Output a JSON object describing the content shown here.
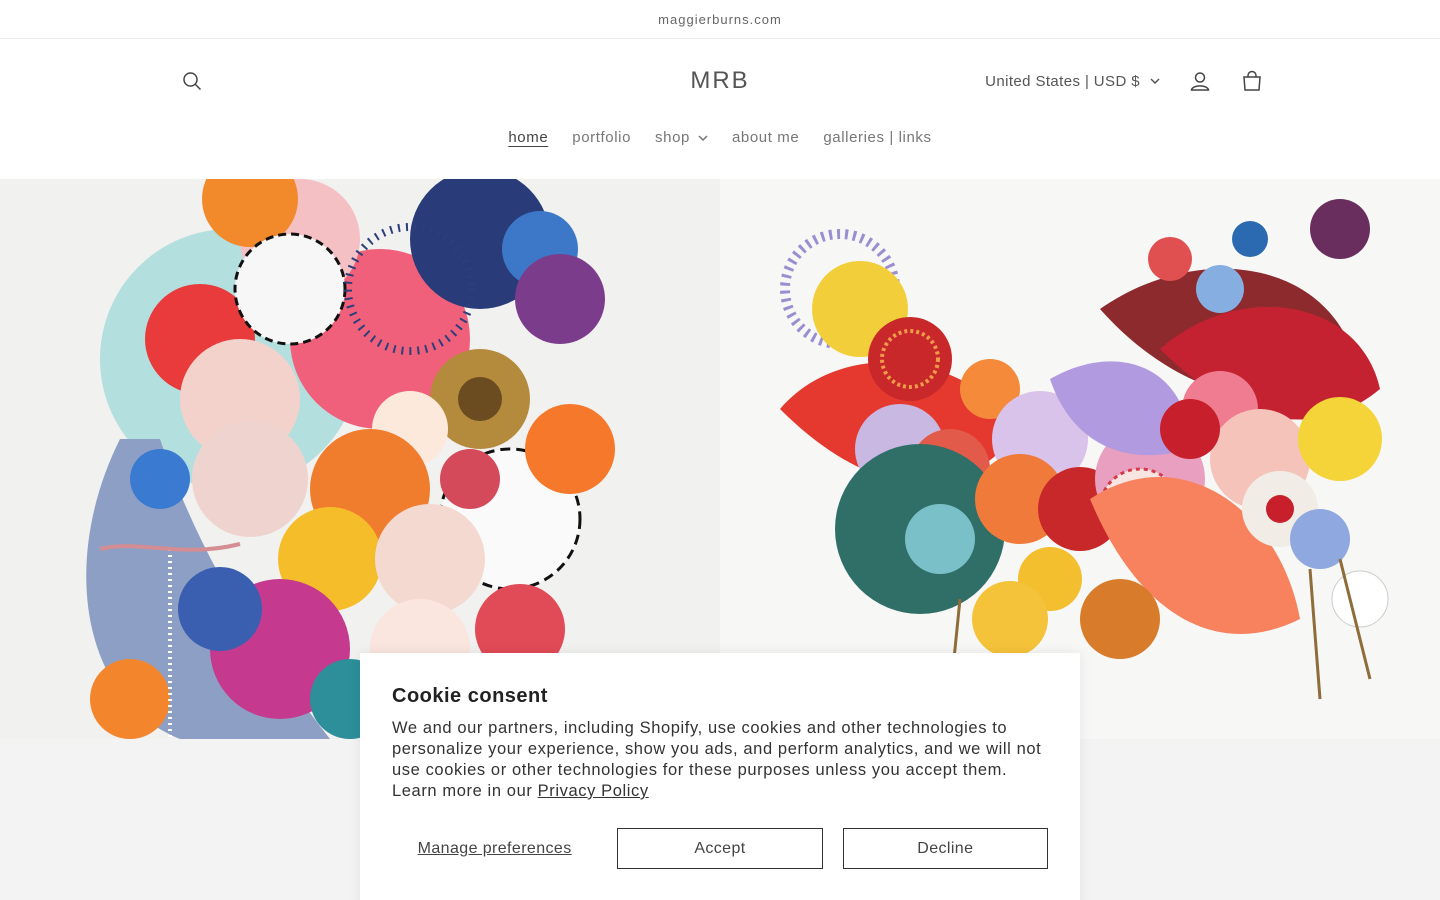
{
  "announcement": {
    "text": "maggierburns.com"
  },
  "header": {
    "logo": "MRB",
    "currency": "United States | USD $",
    "icons": {
      "search": "search-icon",
      "account": "account-icon",
      "cart": "cart-icon",
      "chevron": "chevron-down-icon"
    }
  },
  "nav": {
    "items": [
      {
        "label": "home",
        "active": true
      },
      {
        "label": "portfolio"
      },
      {
        "label": "shop",
        "dropdown": true
      },
      {
        "label": "about me"
      },
      {
        "label": "galleries | links"
      }
    ]
  },
  "cookie": {
    "title": "Cookie consent",
    "body": "We and our partners, including Shopify, use cookies and other technologies to personalize your experience, show you ads, and perform analytics, and we will not use cookies or other technologies for these purposes unless you accept them. Learn more in our ",
    "privacy_link": "Privacy Policy",
    "manage_label": "Manage preferences",
    "accept_label": "Accept",
    "decline_label": "Decline"
  },
  "colors": {
    "text": "#222222",
    "muted": "#777777",
    "border": "#333333"
  }
}
